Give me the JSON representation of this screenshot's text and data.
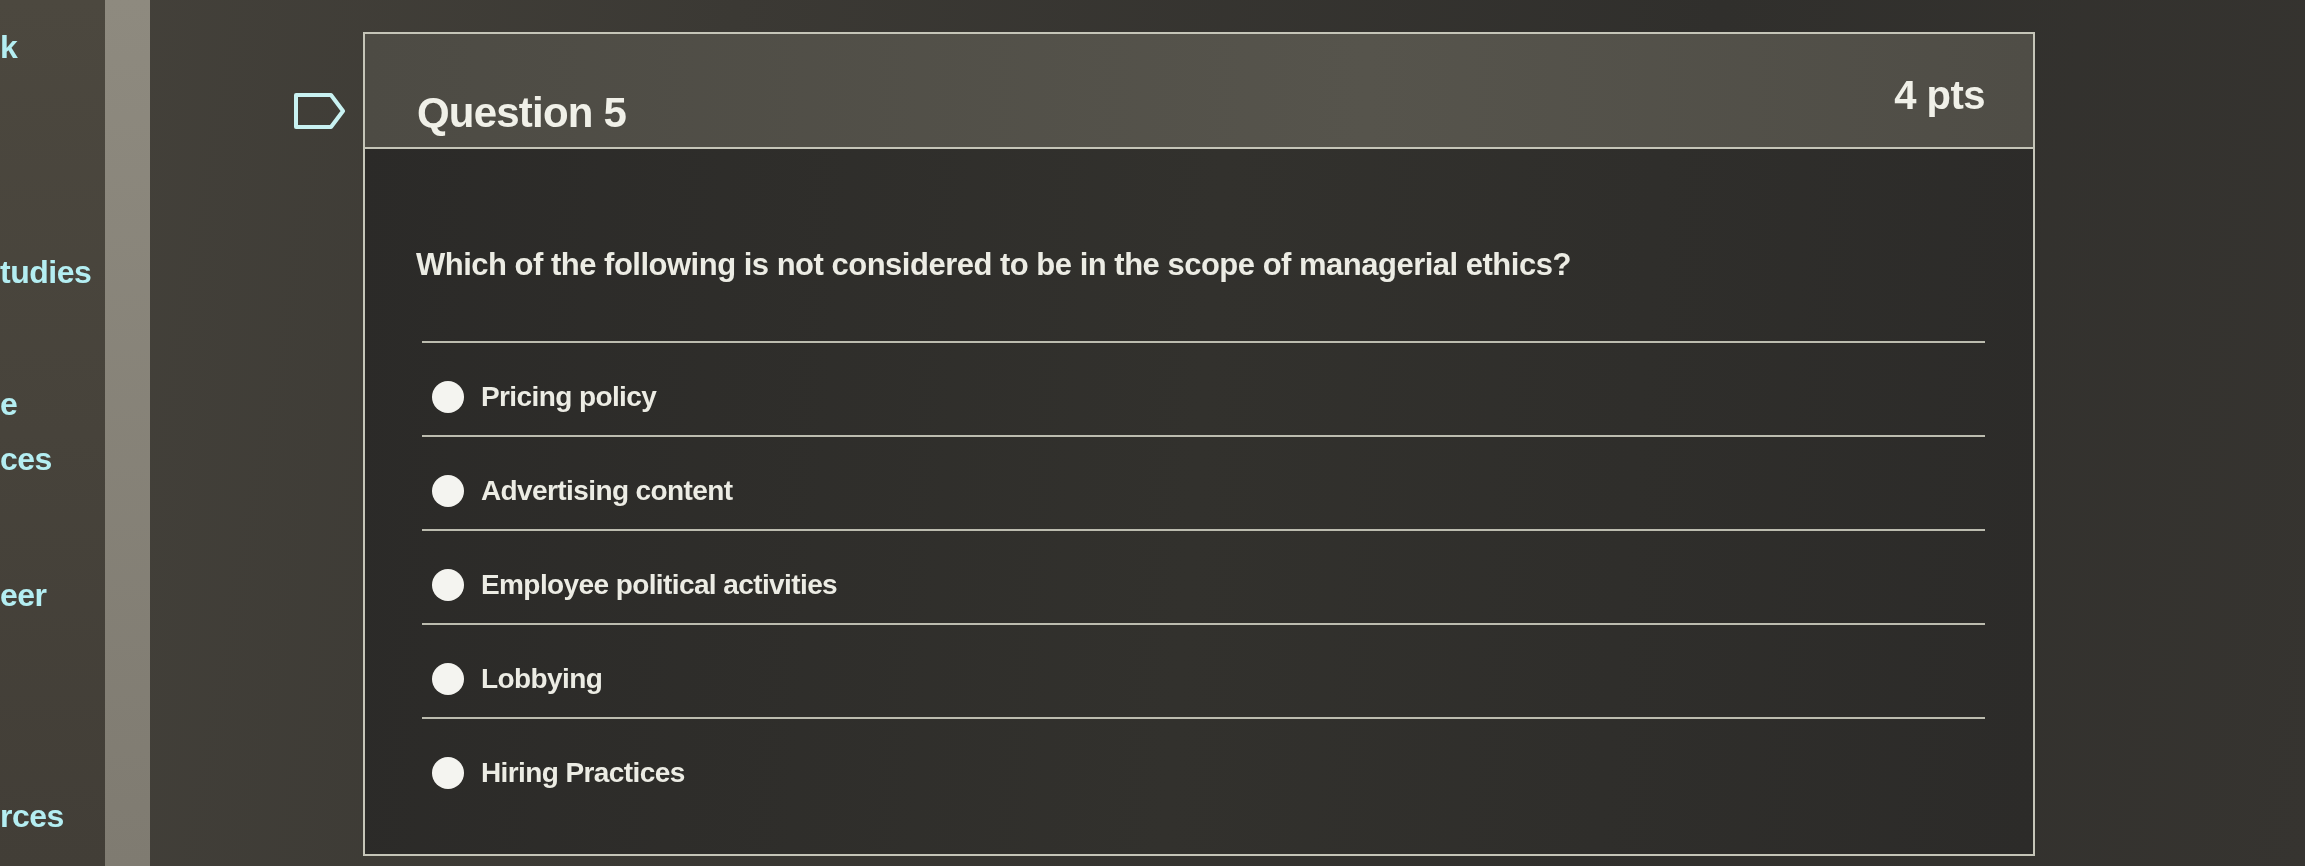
{
  "sidebar": {
    "items": [
      {
        "lines": [
          "k"
        ]
      },
      {
        "lines": [
          "tudies"
        ]
      },
      {
        "lines": [
          "e",
          "ces"
        ]
      },
      {
        "lines": [
          "eer"
        ]
      },
      {
        "lines": [
          "rces"
        ]
      }
    ]
  },
  "question": {
    "flagged": false,
    "title": "Question 5",
    "points": "4 pts",
    "text": "Which of the following is not considered to be in the scope of managerial ethics?",
    "options": [
      {
        "label": "Pricing policy",
        "selected": false
      },
      {
        "label": "Advertising content",
        "selected": false
      },
      {
        "label": "Employee political activities",
        "selected": false
      },
      {
        "label": "Lobbying",
        "selected": false
      },
      {
        "label": "Hiring Practices",
        "selected": false
      }
    ]
  }
}
